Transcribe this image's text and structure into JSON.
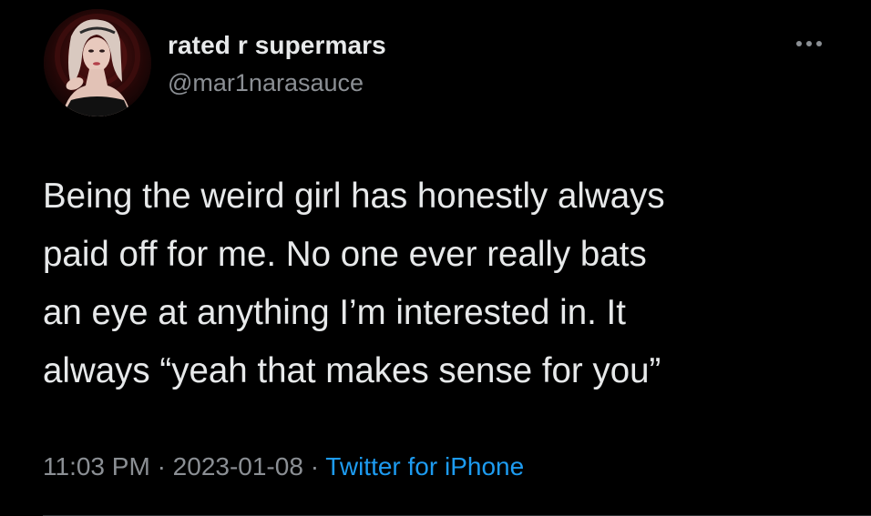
{
  "author": {
    "display_name": "rated r supermars",
    "handle": "@mar1narasauce"
  },
  "tweet": {
    "lines": [
      "Being the weird girl has honestly always",
      "paid off for me. No one ever really bats",
      "an eye at anything I’m interested in. It",
      "always “yeah that makes sense for you”"
    ]
  },
  "meta": {
    "time": "11:03 PM",
    "separator": "·",
    "date": "2023-01-08",
    "source": "Twitter for iPhone"
  },
  "icons": {
    "more": "more-horizontal-icon",
    "avatar": "profile-avatar"
  },
  "colors": {
    "background": "#000000",
    "primary_text": "#e7e9ea",
    "secondary_text": "#8b8f94",
    "link": "#1d9bf0"
  }
}
